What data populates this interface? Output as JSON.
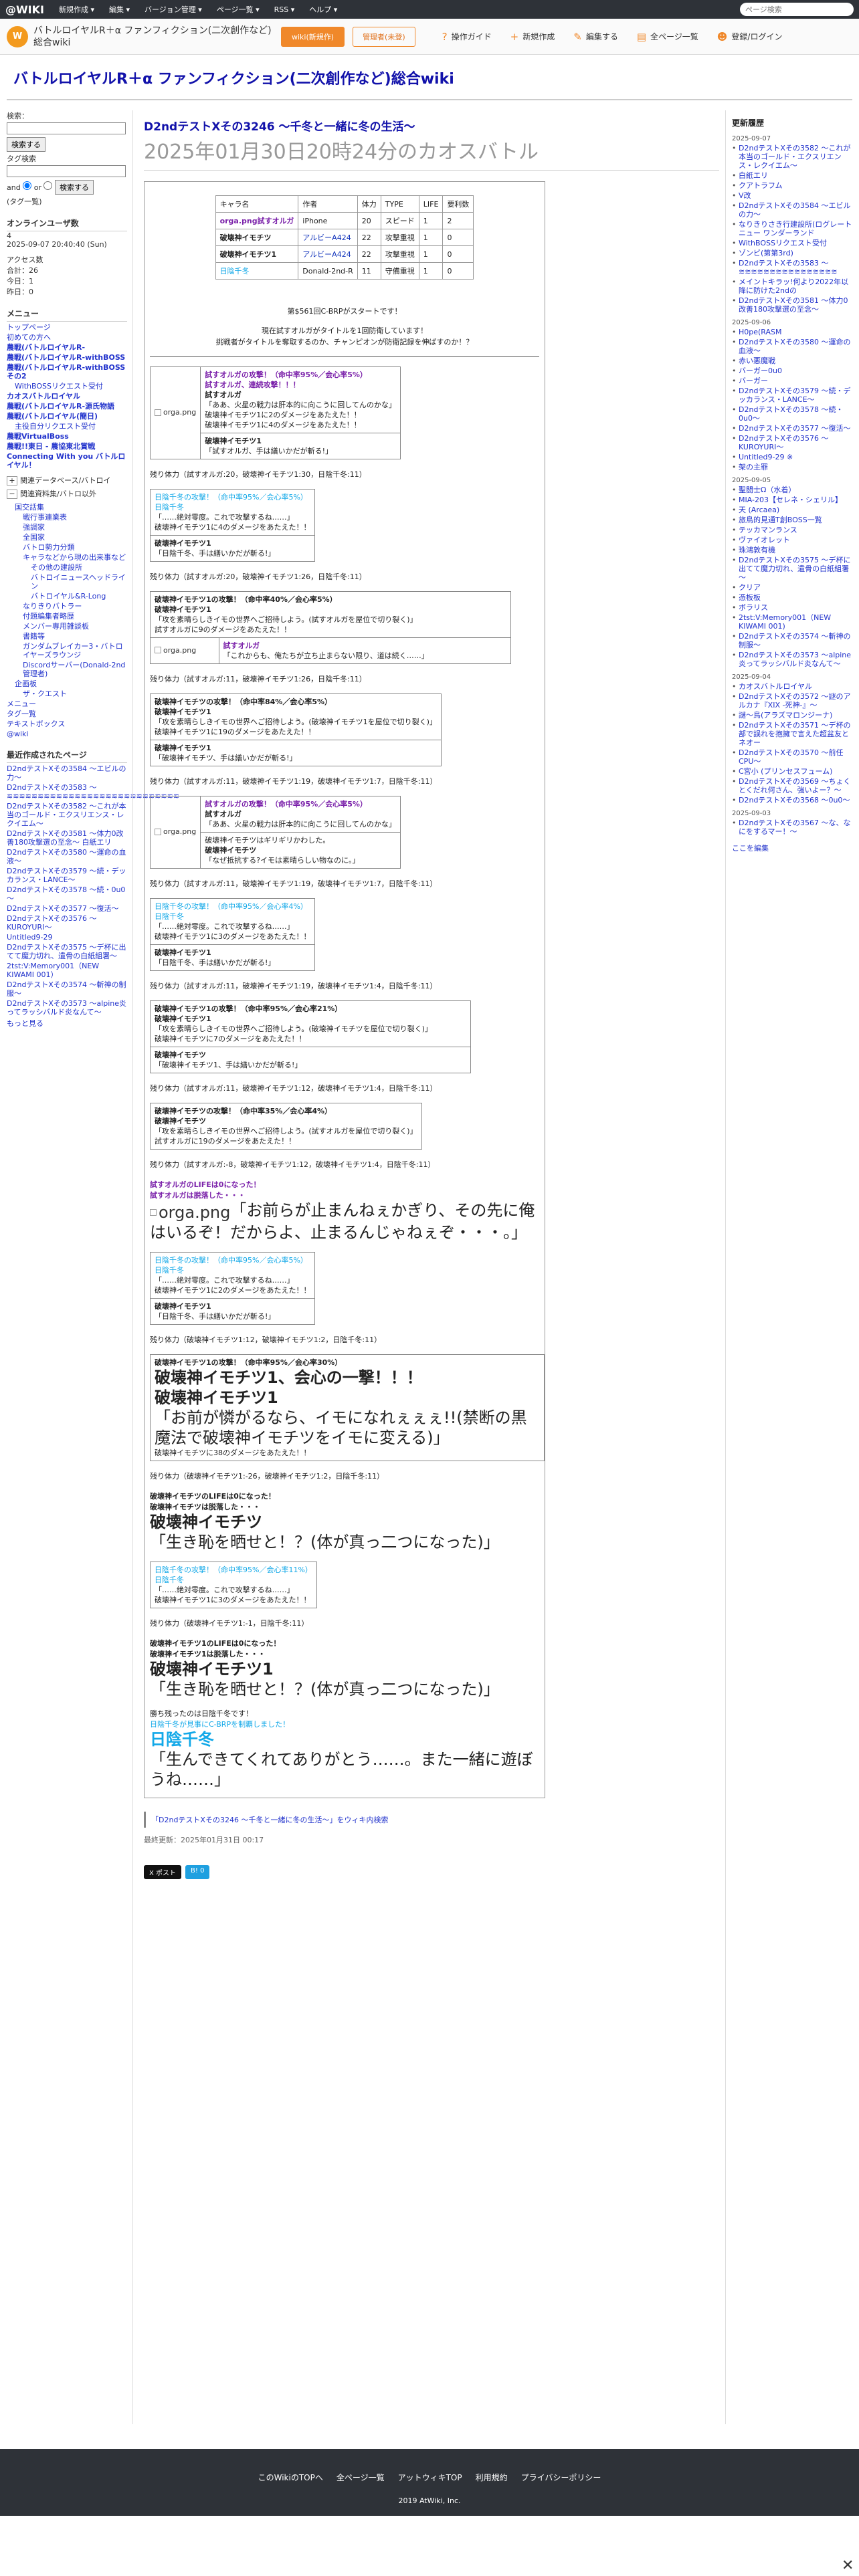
{
  "topbar": {
    "logo": "@WIKI",
    "menu": [
      "新規作成 ▾",
      "編集 ▾",
      "バージョン管理 ▾",
      "ページ一覧 ▾",
      "RSS ▾",
      "ヘルプ ▾"
    ],
    "search_placeholder": "ページ検索"
  },
  "header": {
    "icon": "W",
    "wiki_name": "バトルロイヤルR＋α ファンフィクション(二次創作など)総合wiki",
    "wiki_edit": "wiki(新規作)",
    "member": "管理者(未登)",
    "tools": [
      {
        "icon": "?",
        "label": "操作ガイド"
      },
      {
        "icon": "+",
        "label": "新規作成"
      },
      {
        "icon": "✎",
        "label": "編集する"
      },
      {
        "icon": "▤",
        "label": "全ページ一覧"
      },
      {
        "icon": "☻",
        "label": "登録/ログイン"
      }
    ]
  },
  "title": "バトルロイヤルR＋α ファンフィクション(二次創作など)総合wiki",
  "left": {
    "search_label": "検索：",
    "search_btn": "検索する",
    "tag_label": "タグ検索",
    "and": "and",
    "or": "or",
    "search_btn2": "検索する",
    "tag_cloud": "(タグ一覧)",
    "online": "オンラインユーザ数",
    "online_count": "4",
    "online_date": "2025-09-07 20:40:40 (Sun)",
    "access": "アクセス数",
    "total": "合計：26",
    "today": "今日：1",
    "yesterday": "昨日：0",
    "menu_h": "メニュー",
    "menu": [
      {
        "t": "トップページ",
        "c": ""
      },
      {
        "t": "初めての方へ",
        "c": ""
      },
      {
        "t": "農戦(バトルロイヤルR-",
        "c": "b"
      },
      {
        "t": "農戦(バトルロイヤルR-withBOSS",
        "c": "b"
      },
      {
        "t": "農戦(バトルロイヤルR-withBOSSその2",
        "c": "b"
      },
      {
        "t": "WithBOSSリクエスト受付",
        "c": "sub"
      },
      {
        "t": "カオスバトルロイヤル",
        "c": "b"
      },
      {
        "t": "農戦(バトルロイヤルR-源氏物語",
        "c": "b"
      },
      {
        "t": "農戦(バトルロイヤル(簡日)",
        "c": "b"
      },
      {
        "t": "主役自分リクエスト受付",
        "c": "sub"
      },
      {
        "t": "農戦VirtualBoss",
        "c": "b"
      },
      {
        "t": "農戦!!東日 - 農協東北賞戦",
        "c": "b"
      },
      {
        "t": "Connecting With you バトルロイヤル！",
        "c": "b"
      }
    ],
    "collapse": [
      "関連データベース/バトロイ",
      "関連資料集/バトロ以外"
    ],
    "subs": [
      {
        "t": "国交話集",
        "c": "sub"
      },
      {
        "t": "戦行事連業表",
        "c": "sub2"
      },
      {
        "t": "強調家",
        "c": "sub2"
      },
      {
        "t": "全国家",
        "c": "sub2"
      },
      {
        "t": "バトロ勢力分類",
        "c": "sub2"
      },
      {
        "t": "キャラなどから現の出来事など",
        "c": "sub2"
      },
      {
        "t": "その他の建設所",
        "c": "sub3"
      },
      {
        "t": "バトロイニュースヘッドライン",
        "c": "sub3"
      },
      {
        "t": "バトロイヤル&R-Long",
        "c": "sub3"
      },
      {
        "t": "なりきりバトラー",
        "c": "sub2"
      },
      {
        "t": "付題編集者略歴",
        "c": "sub2"
      },
      {
        "t": "メンバー専用雑談板",
        "c": "sub2"
      },
      {
        "t": "書籍等",
        "c": "sub2"
      },
      {
        "t": "ガンダムブレイカー3・バトロイヤーズラウンジ",
        "c": "sub2"
      },
      {
        "t": "Discordサーバー(Donald-2nd管理者)",
        "c": "sub2"
      },
      {
        "t": "企画板",
        "c": "sub"
      },
      {
        "t": "ザ・クエスト",
        "c": "sub2"
      },
      {
        "t": "メニュー",
        "c": ""
      },
      {
        "t": "タグ一覧",
        "c": ""
      },
      {
        "t": "テキストボックス",
        "c": ""
      },
      {
        "t": "@wiki",
        "c": ""
      }
    ],
    "recent_h": "最近作成されたページ",
    "recent": [
      "D2ndテストXその3584 ～エビルの力～",
      "D2ndテストXその3583 ～≋≋≋≋≋≋≋≋≋≋≋≋≋≋≋≋≋≋≋≋≋≋≋≋≋≋≋≋",
      "D2ndテストXその3582 ～これが本当のゴールド・エクスリエンス・レクイエム～",
      "D2ndテストXその3581 ～体力0改善180攻撃選の至念～ 白紙エリ",
      "D2ndテストXその3580 ～運命の血液～",
      "D2ndテストXその3579 ～続・デッカランス・LANCE～",
      "D2ndテストXその3578 ～続・0u0～",
      "D2ndテストXその3577 ～復活～",
      "D2ndテストXその3576 ～KUROYURI～",
      "Untitled9-29",
      "D2ndテストXその3575 ～デ杯に出てて魔力切れ、遺骨の白紙組署～",
      "2tst:V:Memory001（NEW KIWAMI 001）",
      "D2ndテストXその3574 ～斬神の制服～",
      "D2ndテストXその3573 ～alpine炎ってラッシバルド炎なんて～"
    ],
    "more": "もっと見る"
  },
  "right": {
    "h": "更新履歴",
    "groups": [
      {
        "date": "2025-09-07",
        "items": [
          "D2ndテストXその3582 ～これが本当のゴールド・エクスリエンス・レクイエム～",
          "白紙エリ",
          "クアトラフム",
          "V改",
          "D2ndテストXその3584 ～エビルの力～",
          "なりきりさき行建設所(ログレートニュー ワンダーランド",
          "WithBOSSリクエスト受付",
          "ゾンビ(第第3rd)",
          "D2ndテストXその3583 ～≋≋≋≋≋≋≋≋≋≋≋≋≋≋≋≋",
          "メイントキラッ!何より2022年以降に防けた2ndの",
          "D2ndテストXその3581 ～体力0改善180攻撃選の至念～"
        ]
      },
      {
        "date": "2025-09-06",
        "items": [
          "H0pe(RASM",
          "D2ndテストXその3580 ～運命の血液～",
          "赤い悪魔戦",
          "バーガー0u0",
          "バーガー",
          "D2ndテストXその3579 ～続・デッカランス・LANCE～",
          "D2ndテストXその3578 ～続・0u0～",
          "D2ndテストXその3577 ～復活～",
          "D2ndテストXその3576 ～KUROYURI～",
          "Untitled9-29 ※",
          "架の主罪"
        ]
      },
      {
        "date": "2025-09-05",
        "items": [
          "聖闘士Ω（水着）",
          "MIA-203【セレネ・シェリル】",
          "天 (Arcaea)",
          "旅鳥的見通T創BOSS一覧",
          "テッカマンランス",
          "ヴァイオレット",
          "珠鴻敦有機",
          "D2ndテストXその3575 ～デ杯に出てて魔力切れ、遺骨の白紙組署～",
          "クリア",
          "憑板板",
          "ボラリス",
          "2tst:V:Memory001（NEW KIWAMI 001)",
          "D2ndテストXその3574 ～斬神の制服～",
          "D2ndテストXその3573 ～alpine炎ってラッシバルド炎なんて～"
        ]
      },
      {
        "date": "2025-09-04",
        "items": [
          "カオスバトルロイヤル",
          "D2ndテストXその3572 ～謎のアルカナ『XIX -死神-』～",
          "謎～鳥(アラズマロンジーナ)",
          "D2ndテストXその3571 ～デ杯の部で誤れを抱擁で言えた超盆友とネオー",
          "D2ndテストXその3570 ～前任CPU～",
          "C宮小 (プリンセスフューム)",
          "D2ndテストXその3569 ～ちょくとくだれ何さん、強いよー？～",
          "D2ndテストXその3568 ～0u0～"
        ]
      },
      {
        "date": "2025-09-03",
        "items": [
          "D2ndテストXその3567 ～な、なにをするマー！～"
        ]
      }
    ],
    "more": "ここを編集"
  },
  "main": {
    "h2": "D2ndテストXその3246 ～千冬と一緒に冬の生活～",
    "h1": "2025年01月30日20時24分のカオスバトル",
    "roster_head": [
      "キャラ名",
      "作者",
      "体力",
      "TYPE",
      "LIFE",
      "要利数"
    ],
    "roster": [
      [
        "orga.png試すオルガ",
        "iPhone",
        "20",
        "スピード",
        "1",
        "2"
      ],
      [
        "破壊神イモチツ",
        "アルビーA424",
        "22",
        "攻撃重視",
        "1",
        "0"
      ],
      [
        "破壊神イモチツ1",
        "アルビーA424",
        "22",
        "攻撃重視",
        "1",
        "0"
      ],
      [
        "日陰千冬",
        "Donald-2nd-R",
        "11",
        "守備重視",
        "1",
        "0"
      ]
    ],
    "start": "第$561回C-BRPがスタートです！",
    "intro1": "現在試すオルガがタイトルを1回防衛しています！",
    "intro2": "挑戦者がタイトルを奪取するのか、チャンピオンが防衛記録を伸ばすのか！？",
    "img": "orga.png",
    "hp": [
      "残り体力（試すオルガ:20，破壊神イモチツ1:30，日陰千冬:11）",
      "残り体力（試すオルガ:20，破壊神イモチツ1:26，日陰千冬:11）",
      "残り体力（試すオルガ:11，破壊神イモチツ1:26，日陰千冬:11）",
      "残り体力（試すオルガ:11，破壊神イモチツ1:19，破壊神イモチツ1:7，日陰千冬:11）",
      "残り体力（試すオルガ:11，破壊神イモチツ1:19，破壊神イモチツ1:7，日陰千冬:11）",
      "残り体力（試すオルガ:11，破壊神イモチツ1:19，破壊神イモチツ1:4，日陰千冬:11）",
      "残り体力（試すオルガ:11，破壊神イモチツ1:12，破壊神イモチツ1:4，日陰千冬:11）",
      "残り体力（試すオルガ:-8，破壊神イモチツ1:12，破壊神イモチツ1:4，日陰千冬:11）",
      "残り体力（破壊神イモチツ1:12，破壊神イモチツ1:2，日陰千冬:11）",
      "残り体力（破壊神イモチツ1:-26，破壊神イモチツ1:2，日陰千冬:11）",
      "残り体力（破壊神イモチツ1:-1，日陰千冬:11）"
    ],
    "b1": [
      "試すオルガの攻撃！（命中率95%／会心率5%）",
      "試すオルガ、連続攻撃！！！",
      "試すオルガ",
      "「ああ、火星の戦力は肝本的に向こうに回してんのかな」",
      "破壊神イモチツ1に2のダメージをあたえた！！",
      "破壊神イモチツ1に4のダメージをあたえた！！"
    ],
    "b1r": [
      "破壊神イモチツ1",
      "「試すオルガ、手は繕いかだが斬る!」"
    ],
    "b2": [
      "日陰千冬の攻撃！（命中率95%／会心率5%）",
      "日陰千冬",
      "「……絶対零度。これで攻撃するね……」",
      "破壊神イモチツ1に4のダメージをあたえた！！"
    ],
    "b2r": [
      "破壊神イモチツ1",
      "「日陰千冬、手は繕いかだが斬る!」"
    ],
    "b3": [
      "破壊神イモチツ1の攻撃！（命中率40%／会心率5%）",
      "破壊神イモチツ1",
      "「攻を素晴らしきイモの世界へご招待しよう。(試すオルガを屋位で切り裂く)」",
      "試すオルガに9のダメージをあたえた！！"
    ],
    "b3r": [
      "試すオルガ",
      "「これからも、俺たちが立ち止まらない限り、道は続く……」"
    ],
    "b4": [
      "破壊神イモチツの攻撃！（命中率84%／会心率5%）",
      "破壊神イモチツ1",
      "「攻を素晴らしきイモの世界へご招待しよう。(破壊神イモチツ1を屋位で切り裂く)」",
      "破壊神イモチツ1に19のダメージをあたえた！！"
    ],
    "b4r": [
      "破壊神イモチツ1",
      "「破壊神イモチツ、手は繕いかだが斬る!」"
    ],
    "b5": [
      "試すオルガの攻撃！（命中率95%／会心率5%）",
      "試すオルガ",
      "「ああ、火星の戦力は肝本的に向こうに回してんのかな」"
    ],
    "b5r": [
      "破壊神イモチツはギリギリかわした。",
      "破壊神イモチツ",
      "「なぜ抵抗する?イモは素晴らしい物なのに。」"
    ],
    "b6": [
      "日陰千冬の攻撃！（命中率95%／会心率4%）",
      "日陰千冬",
      "「……絶対零度。これで攻撃するね……」",
      "破壊神イモチツ1に3のダメージをあたえた！！"
    ],
    "b6r": [
      "破壊神イモチツ1",
      "「日陰千冬、手は繕いかだが斬る!」"
    ],
    "b7": [
      "破壊神イモチツ1の攻撃！（命中率95%／会心率21%）",
      "破壊神イモチツ1",
      "「攻を素晴らしきイモの世界へご招待しよう。(破壊神イモチツを屋位で切り裂く)」",
      "破壊神イモチツに7のダメージをあたえた！！"
    ],
    "b7r": [
      "破壊神イモチツ",
      "「破壊神イモチツ1、手は繕いかだが斬る!」"
    ],
    "b8": [
      "破壊神イモチツの攻撃！（命中率35%／会心率4%）",
      "破壊神イモチツ",
      "「攻を素晴らしきイモの世界へご招待しよう。(試すオルガを屋位で切り裂く)」",
      "試すオルガに19のダメージをあたえた！！"
    ],
    "ko1": [
      "試すオルガのLIFEは0になった！",
      "試すオルガは脱落した・・・"
    ],
    "orga_last": "「お前らが止まんねぇかぎり、その先に俺はいるぞ！だからよ、止まるんじゃねぇぞ・・・。」",
    "b9": [
      "日陰千冬の攻撃！（命中率95%／会心率5%）",
      "日陰千冬",
      "「……絶対零度。これで攻撃するね……」",
      "破壊神イモチツ1に2のダメージをあたえた！！"
    ],
    "b9r": [
      "破壊神イモチツ1",
      "「日陰千冬、手は繕いかだが斬る!」"
    ],
    "b10": [
      "破壊神イモチツ1の攻撃！（命中率95%／会心率30%）",
      "破壊神イモチツ1、会心の一撃！！！",
      "破壊神イモチツ1",
      "「お前が憐がるなら、イモになれぇぇぇ!!(禁断の黒魔法で破壊神イモチツをイモに変える)」",
      "破壊神イモチツに38のダメージをあたえた！！"
    ],
    "ko2": [
      "破壊神イモチツのLIFEは0になった！",
      "破壊神イモチツは脱落した・・・"
    ],
    "ko2_name": "破壊神イモチツ",
    "ko2_line": "「生き恥を晒せと！？(体が真っ二つになった)」",
    "b11": [
      "日陰千冬の攻撃！（命中率95%／会心率11%）",
      "日陰千冬",
      "「……絶対零度。これで攻撃するね……」",
      "破壊神イモチツ1に3のダメージをあたえた！！"
    ],
    "ko3": [
      "破壊神イモチツ1のLIFEは0になった！",
      "破壊神イモチツ1は脱落した・・・"
    ],
    "ko3_name": "破壊神イモチツ1",
    "ko3_line": "「生き恥を晒せと！？(体が真っ二つになった)」",
    "win": [
      "勝ち残ったのは日陰千冬です！",
      "日陰千冬が見事にC-BRPを制覇しました！"
    ],
    "win_name": "日陰千冬",
    "win_line": "「生んできてくれてありがとう……。また一緒に遊ぼうね……」"
  },
  "below": {
    "ref": "「D2ndテストXその3246 ～千冬と一緒に冬の生活～」をウィキ内検索",
    "last": "最終更新：2025年01月31日 00:17",
    "share": [
      "X ポスト",
      "B! 0"
    ]
  },
  "footer": {
    "links": [
      "このWikiのTOPへ",
      "全ページ一覧",
      "アットウィキTOP",
      "利用規約",
      "プライバシーポリシー"
    ],
    "copy": "2019 AtWiki, Inc."
  },
  "colors": {
    "accent": "#f0882a",
    "topbar": "#2e3238",
    "title": "#1111aa",
    "red": "#e52222",
    "blue": "#11a8e8"
  }
}
